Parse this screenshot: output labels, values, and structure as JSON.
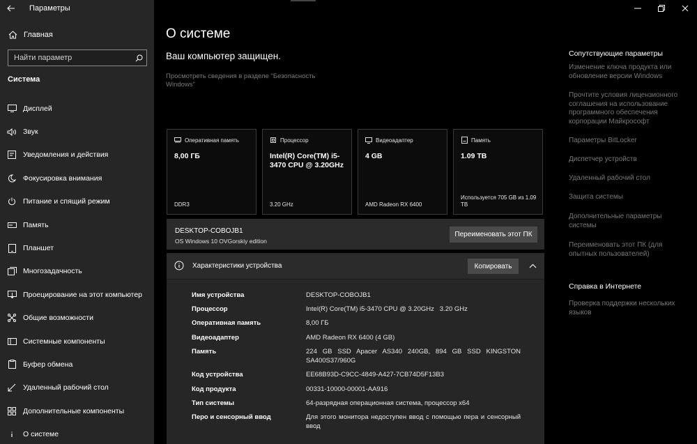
{
  "window": {
    "app_title": "Параметры",
    "controls": {
      "minimize": "—",
      "maximize": "❐",
      "close": "✕"
    }
  },
  "sidebar": {
    "home_label": "Главная",
    "search_placeholder": "Найти параметр",
    "section_title": "Система",
    "items": [
      {
        "label": "Дисплей",
        "icon": "monitor-icon"
      },
      {
        "label": "Звук",
        "icon": "speaker-icon"
      },
      {
        "label": "Уведомления и действия",
        "icon": "notification-icon"
      },
      {
        "label": "Фокусировка внимания",
        "icon": "moon-icon"
      },
      {
        "label": "Питание и спящий режим",
        "icon": "power-icon"
      },
      {
        "label": "Память",
        "icon": "storage-icon"
      },
      {
        "label": "Планшет",
        "icon": "tablet-icon"
      },
      {
        "label": "Многозадачность",
        "icon": "multitask-icon"
      },
      {
        "label": "Проецирование на этот компьютер",
        "icon": "project-icon"
      },
      {
        "label": "Общие возможности",
        "icon": "shared-icon"
      },
      {
        "label": "Системные компоненты",
        "icon": "components-icon"
      },
      {
        "label": "Буфер обмена",
        "icon": "clipboard-icon"
      },
      {
        "label": "Удаленный рабочий стол",
        "icon": "remote-icon"
      },
      {
        "label": "Дополнительные компоненты",
        "icon": "optional-icon"
      },
      {
        "label": "О системе",
        "icon": "info-icon",
        "active": true
      }
    ]
  },
  "main": {
    "title": "О системе",
    "protection_status": "Ваш компьютер защищен.",
    "security_link": "Просмотреть сведения в разделе \"Безопасность Windows\"",
    "cards": [
      {
        "label": "Оперативная память",
        "value": "8,00 ГБ",
        "footer": "DDR3",
        "icon": "ram-icon"
      },
      {
        "label": "Процессор",
        "value": "Intel(R) Core(TM) i5-3470 CPU @ 3.20GHz",
        "footer": "3.20 GHz",
        "icon": "cpu-icon"
      },
      {
        "label": "Видеоадаптер",
        "value": "4 GB",
        "footer": "AMD Radeon RX 6400",
        "icon": "gpu-icon"
      },
      {
        "label": "Память",
        "value": "1.09 TB",
        "footer": "Используется 705 GB из 1.09 TB",
        "icon": "disk-icon"
      }
    ],
    "pc": {
      "name": "DESKTOP-COBOJB1",
      "edition": "OS Windows 10 OVGorskiy edition",
      "rename_label": "Переименовать этот ПК"
    },
    "specs": {
      "title": "Характеристики устройства",
      "copy_label": "Копировать",
      "rows": [
        {
          "key": "Имя устройства",
          "value": "DESKTOP-COBOJB1"
        },
        {
          "key": "Процессор",
          "value": "Intel(R) Core(TM) i5-3470 CPU @ 3.20GHz   3.20 GHz"
        },
        {
          "key": "Оперативная память",
          "value": "8,00 ГБ"
        },
        {
          "key": "Видеоадаптер",
          "value": "AMD Radeon RX 6400 (4 GB)"
        },
        {
          "key": "Память",
          "value": "224 GB SSD Apacer AS340 240GB, 894 GB SSD KINGSTON SA400S37/960G"
        },
        {
          "key": "Код устройства",
          "value": "EE68B93D-C9CC-4849-A427-7CB74D5F13B3"
        },
        {
          "key": "Код продукта",
          "value": "00331-10000-00001-AA916"
        },
        {
          "key": "Тип системы",
          "value": "64-разрядная операционная система, процессор x64"
        },
        {
          "key": "Перо и сенсорный ввод",
          "value": "Для этого монитора недоступен ввод с помощью пера и сенсорный ввод"
        }
      ]
    }
  },
  "related": {
    "title": "Сопутствующие параметры",
    "links": [
      "Изменение ключа продукта или обновление версии Windows",
      "Прочтите условия лицензионного соглашения на использование программного обеспечения корпорации Майкрософт",
      "Параметры BitLocker",
      "Диспетчер устройств",
      "Удаленный рабочий стол",
      "Защита системы",
      "Дополнительные параметры системы",
      "Переименовать этот ПК (для опытных пользователей)"
    ],
    "help_title": "Справка в Интернете",
    "help_links": [
      "Проверка поддержки нескольких языков"
    ]
  }
}
